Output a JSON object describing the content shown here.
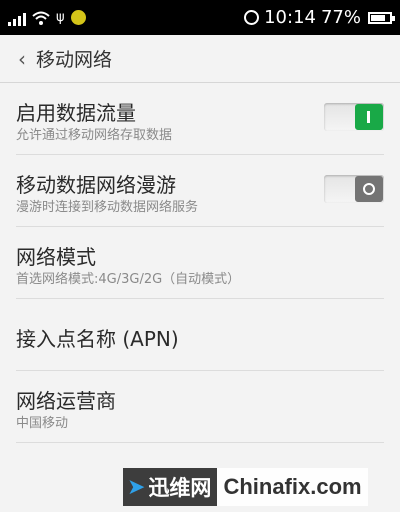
{
  "status_bar": {
    "time": "10:14",
    "battery_percent_text": "77%",
    "battery_level": 0.77,
    "icons": [
      "signal-icon",
      "wifi-icon",
      "usb-icon",
      "notification-icon",
      "alarm-icon",
      "battery-icon"
    ]
  },
  "header": {
    "back_glyph": "‹",
    "title": "移动网络"
  },
  "rows": [
    {
      "title": "启用数据流量",
      "subtitle": "允许通过移动网络存取数据",
      "toggle": "on"
    },
    {
      "title": "移动数据网络漫游",
      "subtitle": "漫游时连接到移动数据网络服务",
      "toggle": "off"
    },
    {
      "title": "网络模式",
      "subtitle": "首选网络模式:4G/3G/2G（自动模式）"
    },
    {
      "title": "接入点名称 (APN)"
    },
    {
      "title": "网络运营商",
      "subtitle": "中国移动"
    }
  ],
  "watermark": {
    "logo_text": "迅维网",
    "site_text": "Chinafix.com"
  },
  "colors": {
    "status_bar_bg": "#000000",
    "page_bg": "#f3f3f3",
    "toggle_on": "#19a947",
    "toggle_off": "#747474"
  }
}
